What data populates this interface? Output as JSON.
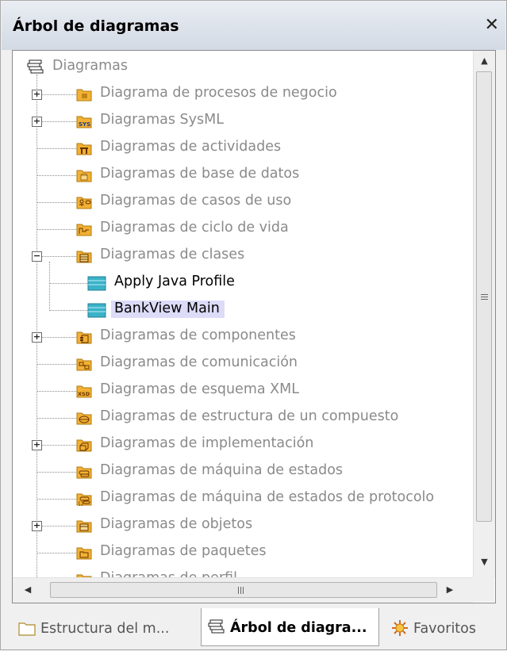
{
  "panel": {
    "title": "Árbol de diagramas",
    "close_symbol": "✕"
  },
  "tree": {
    "root_label": "Diagramas",
    "items": [
      {
        "label": "Diagrama de procesos de negocio",
        "icon": "folder-icon",
        "expander": "+"
      },
      {
        "label": "Diagramas SysML",
        "icon": "sysml-icon",
        "expander": "+"
      },
      {
        "label": "Diagramas de actividades",
        "icon": "activity-diagram-icon",
        "expander": ""
      },
      {
        "label": "Diagramas de base de datos",
        "icon": "database-diagram-icon",
        "expander": ""
      },
      {
        "label": "Diagramas de casos de uso",
        "icon": "use-case-icon",
        "expander": ""
      },
      {
        "label": "Diagramas de ciclo de vida",
        "icon": "lifecycle-icon",
        "expander": ""
      },
      {
        "label": "Diagramas de clases",
        "icon": "class-diagram-icon",
        "expander": "−"
      },
      {
        "label": "Diagramas de componentes",
        "icon": "component-icon",
        "expander": "+"
      },
      {
        "label": "Diagramas de comunicación",
        "icon": "communication-icon",
        "expander": ""
      },
      {
        "label": "Diagramas de esquema XML",
        "icon": "xsd-icon",
        "expander": ""
      },
      {
        "label": "Diagramas de estructura de un compuesto",
        "icon": "composite-structure-icon",
        "expander": ""
      },
      {
        "label": "Diagramas de implementación",
        "icon": "deployment-icon",
        "expander": "+"
      },
      {
        "label": "Diagramas de máquina de estados",
        "icon": "state-machine-icon",
        "expander": ""
      },
      {
        "label": "Diagramas de máquina de estados de protocolo",
        "icon": "protocol-state-machine-icon",
        "expander": ""
      },
      {
        "label": "Diagramas de objetos",
        "icon": "object-diagram-icon",
        "expander": "+"
      },
      {
        "label": "Diagramas de paquetes",
        "icon": "package-diagram-icon",
        "expander": ""
      },
      {
        "label": "Diagramas de perfil",
        "icon": "profile-diagram-icon",
        "expander": ""
      }
    ],
    "class_children": [
      {
        "label": "Apply Java Profile",
        "icon": "class-diagram-file-icon"
      },
      {
        "label": "BankView Main",
        "icon": "class-diagram-file-icon"
      }
    ],
    "selected": "BankView Main"
  },
  "scrollbars": {
    "up": "▲",
    "down": "▼",
    "left": "◀",
    "right": "▶"
  },
  "tabs": [
    {
      "label": "Estructura del m...",
      "icon": "folder-outline-icon",
      "active": false
    },
    {
      "label": "Árbol de diagra...",
      "icon": "diagram-tree-icon",
      "active": true
    },
    {
      "label": "Favoritos",
      "icon": "favorites-icon",
      "active": false
    }
  ],
  "colors": {
    "folder": "#f2b134",
    "teal": "#3bb2c8",
    "selection": "#dcdcf8",
    "dim_text": "#8a8a8a"
  }
}
